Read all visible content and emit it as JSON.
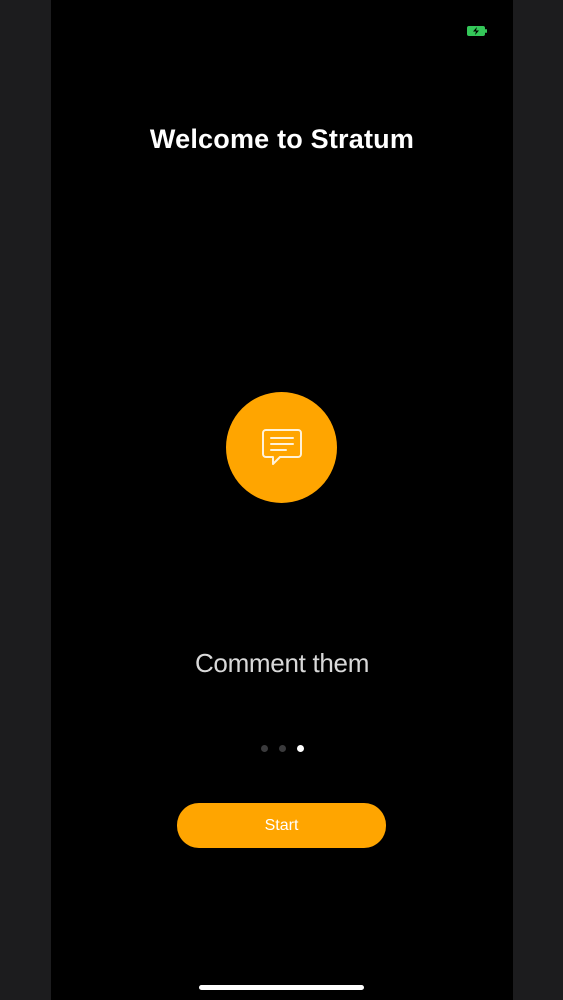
{
  "app": {
    "title": "Welcome to Stratum"
  },
  "status_bar": {
    "battery_icon": "battery-charging-icon",
    "battery_color": "#34c759"
  },
  "onboarding": {
    "feature_icon": "speech-bubble-icon",
    "accent_color": "#ffa500",
    "caption": "Comment them",
    "page_count": 3,
    "current_page": 3
  },
  "actions": {
    "start_label": "Start"
  }
}
